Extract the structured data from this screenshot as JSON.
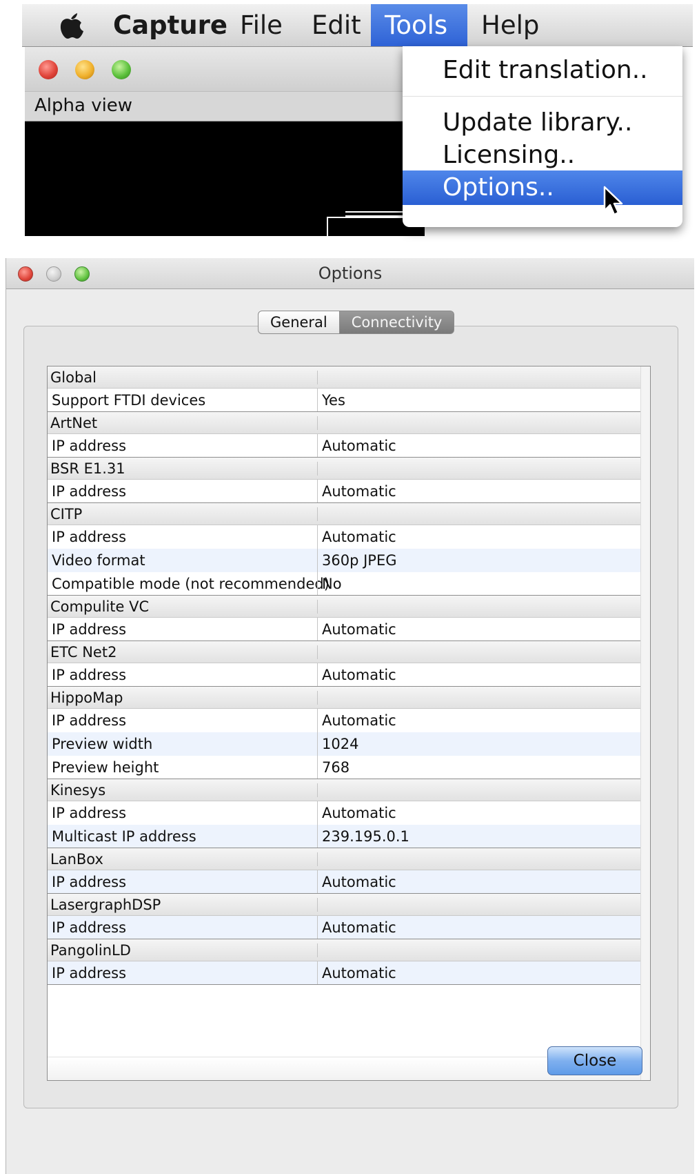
{
  "menubar": {
    "apple_icon": "apple-icon",
    "app_name": "Capture",
    "items": [
      "File",
      "Edit",
      "Tools",
      "Help"
    ],
    "active_item": "Tools"
  },
  "background_window": {
    "panel_title": "Alpha view"
  },
  "tools_menu": {
    "items": [
      "Edit translation..",
      "Update library..",
      "Licensing..",
      "Options.."
    ],
    "highlighted": "Options.."
  },
  "options_dialog": {
    "title": "Options",
    "tabs": [
      "General",
      "Connectivity"
    ],
    "selected_tab": "Connectivity",
    "close_label": "Close",
    "rows": [
      {
        "type": "group",
        "key": "Global"
      },
      {
        "type": "item",
        "key": "Support FTDI devices",
        "value": "Yes"
      },
      {
        "type": "group",
        "key": "ArtNet"
      },
      {
        "type": "item",
        "key": "IP address",
        "value": "Automatic"
      },
      {
        "type": "group",
        "key": "BSR E1.31"
      },
      {
        "type": "item",
        "key": "IP address",
        "value": "Automatic"
      },
      {
        "type": "group",
        "key": "CITP"
      },
      {
        "type": "item",
        "key": "IP address",
        "value": "Automatic"
      },
      {
        "type": "item",
        "key": "Video format",
        "value": "360p JPEG"
      },
      {
        "type": "item",
        "key": "Compatible mode (not recommended)",
        "value": "No"
      },
      {
        "type": "group",
        "key": "Compulite VC"
      },
      {
        "type": "item",
        "key": "IP address",
        "value": "Automatic"
      },
      {
        "type": "group",
        "key": "ETC Net2"
      },
      {
        "type": "item",
        "key": "IP address",
        "value": "Automatic"
      },
      {
        "type": "group",
        "key": "HippoMap"
      },
      {
        "type": "item",
        "key": "IP address",
        "value": "Automatic"
      },
      {
        "type": "item",
        "key": "Preview width",
        "value": "1024"
      },
      {
        "type": "item",
        "key": "Preview height",
        "value": "768"
      },
      {
        "type": "group",
        "key": "Kinesys"
      },
      {
        "type": "item",
        "key": "IP address",
        "value": "Automatic"
      },
      {
        "type": "item",
        "key": "Multicast IP address",
        "value": "239.195.0.1"
      },
      {
        "type": "group",
        "key": "LanBox"
      },
      {
        "type": "item",
        "key": "IP address",
        "value": "Automatic"
      },
      {
        "type": "group",
        "key": "LasergraphDSP"
      },
      {
        "type": "item",
        "key": "IP address",
        "value": "Automatic"
      },
      {
        "type": "group",
        "key": "PangolinLD"
      },
      {
        "type": "item",
        "key": "IP address",
        "value": "Automatic"
      }
    ]
  }
}
